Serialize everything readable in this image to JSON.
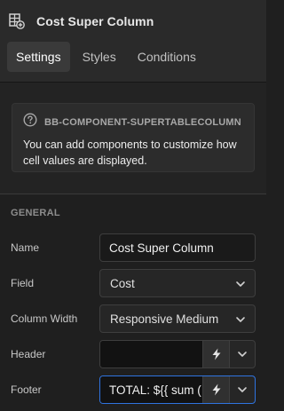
{
  "header": {
    "title": "Cost Super Column",
    "icon": "table-add-icon"
  },
  "tabs": [
    {
      "label": "Settings",
      "active": true
    },
    {
      "label": "Styles",
      "active": false
    },
    {
      "label": "Conditions",
      "active": false
    }
  ],
  "info": {
    "icon": "help-circle-icon",
    "title": "BB-COMPONENT-SUPERTABLECOLUMN",
    "text": "You can add components to customize how cell values are displayed."
  },
  "general": {
    "section_label": "GENERAL",
    "name": {
      "label": "Name",
      "value": "Cost Super Column"
    },
    "field": {
      "label": "Field",
      "value": "Cost"
    },
    "column_width": {
      "label": "Column Width",
      "value": "Responsive Medium"
    },
    "header": {
      "label": "Header",
      "value": ""
    },
    "footer": {
      "label": "Footer",
      "value": "TOTAL: ${{ sum ("
    }
  },
  "colors": {
    "background": "#1f1f1f",
    "panel": "#2a2a2a",
    "focus_border": "#2f74e0"
  }
}
